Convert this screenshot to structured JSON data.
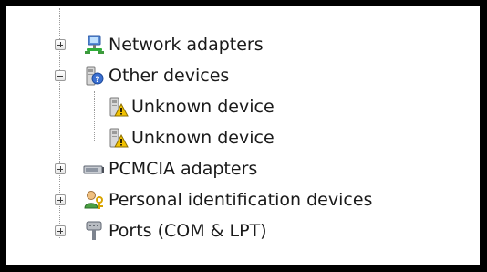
{
  "tree": {
    "items": [
      {
        "label": "Network adapters",
        "icon": "network-adapter-icon",
        "expander": "collapsed"
      },
      {
        "label": "Other devices",
        "icon": "unknown-device-category-icon",
        "expander": "expanded"
      },
      {
        "label": "Unknown device",
        "icon": "warning-device-icon"
      },
      {
        "label": "Unknown device",
        "icon": "warning-device-icon"
      },
      {
        "label": "PCMCIA adapters",
        "icon": "pcmcia-adapter-icon",
        "expander": "collapsed"
      },
      {
        "label": "Personal identification devices",
        "icon": "personal-identification-icon",
        "expander": "collapsed"
      },
      {
        "label": "Ports (COM & LPT)",
        "icon": "ports-icon",
        "expander": "collapsed"
      }
    ]
  },
  "colors": {
    "frame": "#000000",
    "background": "#ffffff",
    "text": "#1a1a1a",
    "warning": "#f2c200"
  }
}
